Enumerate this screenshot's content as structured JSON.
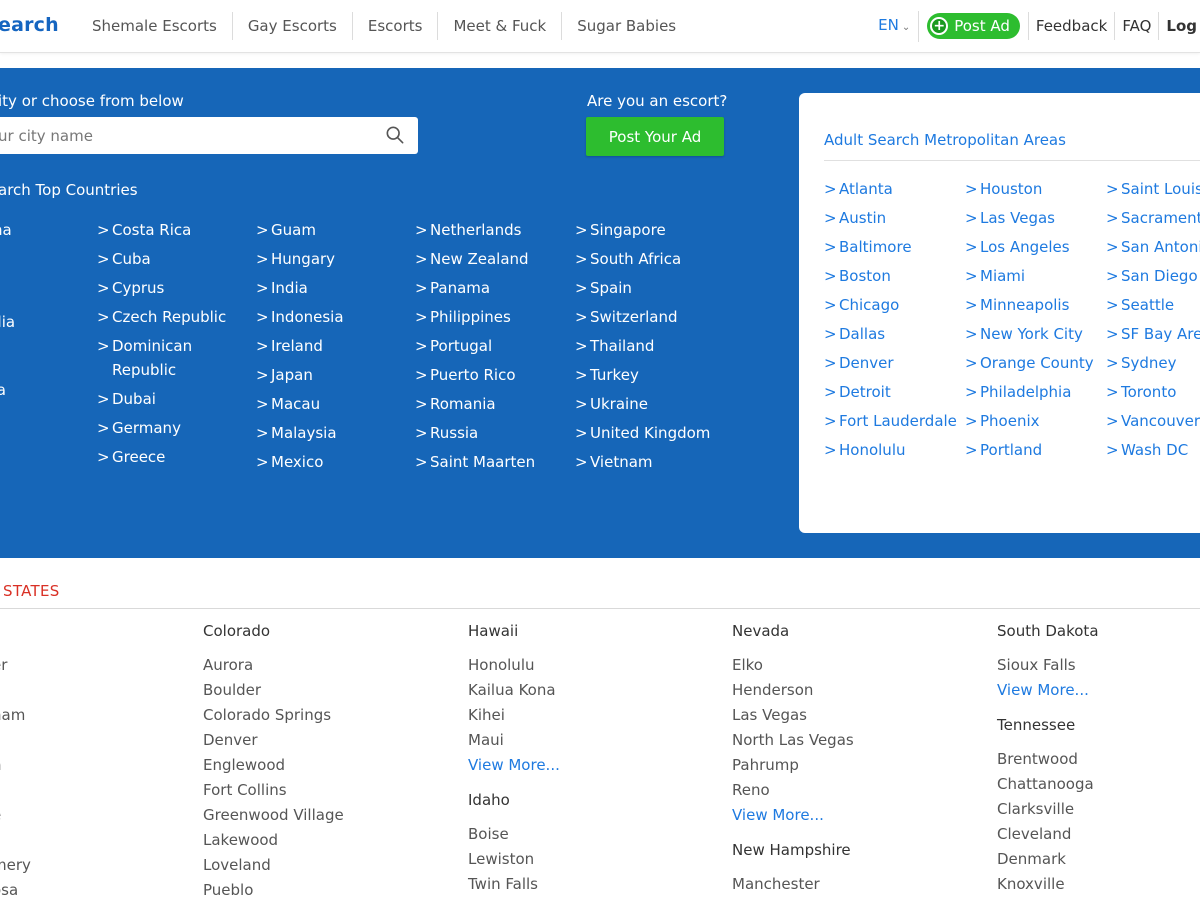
{
  "header": {
    "logo": "earch",
    "nav": [
      "Shemale Escorts",
      "Gay Escorts",
      "Escorts",
      "Meet & Fuck",
      "Sugar Babies"
    ],
    "lang": "EN",
    "post_ad": "Post Ad",
    "feedback": "Feedback",
    "faq": "FAQ",
    "login": "Log"
  },
  "hero": {
    "search_label": "ity or choose from below",
    "search_placeholder": "ur city name",
    "escort_question": "Are you an escort?",
    "post_your_ad": "Post Your Ad",
    "countries_title": "arch Top Countries"
  },
  "countries": [
    [
      "tina",
      "lia",
      "",
      "m",
      "odia",
      "a",
      "",
      "",
      "bia"
    ],
    [
      "Costa Rica",
      "Cuba",
      "Cyprus",
      "Czech Republic",
      "Dominican Republic",
      "Dubai",
      "Germany",
      "Greece"
    ],
    [
      "Guam",
      "Hungary",
      "India",
      "Indonesia",
      "Ireland",
      "Japan",
      "Macau",
      "Malaysia",
      "Mexico"
    ],
    [
      "Netherlands",
      "New Zealand",
      "Panama",
      "Philippines",
      "Portugal",
      "Puerto Rico",
      "Romania",
      "Russia",
      "Saint Maarten"
    ],
    [
      "Singapore",
      "South Africa",
      "Spain",
      "Switzerland",
      "Thailand",
      "Turkey",
      "Ukraine",
      "United Kingdom",
      "Vietnam"
    ]
  ],
  "metro": {
    "title": "Adult Search Metropolitan Areas",
    "columns": [
      [
        "Atlanta",
        "Austin",
        "Baltimore",
        "Boston",
        "Chicago",
        "Dallas",
        "Denver",
        "Detroit",
        "Fort Lauderdale",
        "Honolulu"
      ],
      [
        "Houston",
        "Las Vegas",
        "Los Angeles",
        "Miami",
        "Minneapolis",
        "New York City",
        "Orange County",
        "Philadelphia",
        "Phoenix",
        "Portland"
      ],
      [
        "Saint Louis",
        "Sacrament",
        "San Antoni",
        "San Diego",
        "Seattle",
        "SF Bay Are",
        "Sydney",
        "Toronto",
        "Vancouver",
        "Wash DC"
      ]
    ]
  },
  "states": {
    "title": "STATES",
    "view_more": "View More...",
    "columns": [
      [
        {
          "name": "a",
          "cities": [
            "er",
            "",
            "ham",
            "",
            "n",
            "",
            "e",
            "",
            "mery",
            "osa"
          ]
        }
      ],
      [
        {
          "name": "Colorado",
          "cities": [
            "Aurora",
            "Boulder",
            "Colorado Springs",
            "Denver",
            "Englewood",
            "Fort Collins",
            "Greenwood Village",
            "Lakewood",
            "Loveland",
            "Pueblo"
          ]
        }
      ],
      [
        {
          "name": "Hawaii",
          "cities": [
            "Honolulu",
            "Kailua Kona",
            "Kihei",
            "Maui"
          ],
          "more": true
        },
        {
          "name": "Idaho",
          "cities": [
            "Boise",
            "Lewiston",
            "Twin Falls"
          ]
        }
      ],
      [
        {
          "name": "Nevada",
          "cities": [
            "Elko",
            "Henderson",
            "Las Vegas",
            "North Las Vegas",
            "Pahrump",
            "Reno"
          ],
          "more": true
        },
        {
          "name": "New Hampshire",
          "cities": [
            "Manchester"
          ]
        }
      ],
      [
        {
          "name": "South Dakota",
          "cities": [
            "Sioux Falls"
          ],
          "more": true
        },
        {
          "name": "Tennessee",
          "cities": [
            "Brentwood",
            "Chattanooga",
            "Clarksville",
            "Cleveland",
            "Denmark",
            "Knoxville"
          ]
        }
      ]
    ]
  },
  "colors": {
    "hero_blue": "#1666b8",
    "green": "#2dbd2f",
    "link_blue": "#1e7ae0",
    "states_red": "#d93025"
  }
}
